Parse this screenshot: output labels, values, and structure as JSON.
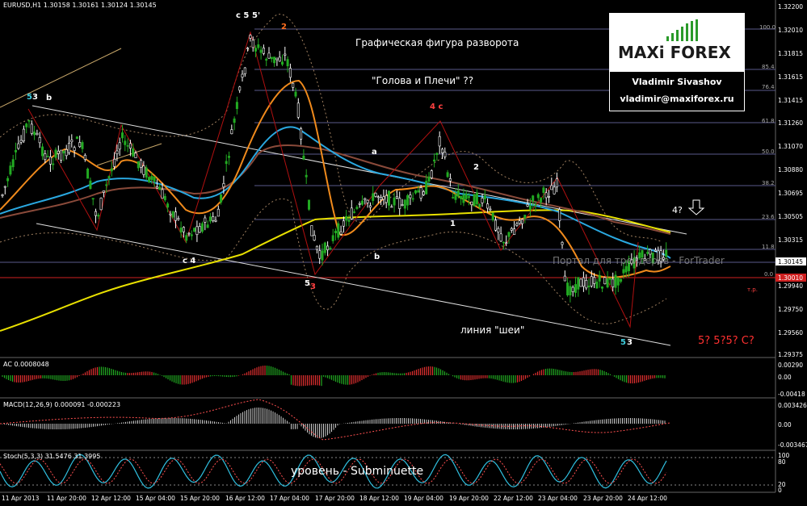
{
  "window": {
    "symbol_header": "EURUSD,H1  1.30158 1.30161 1.30124 1.30145"
  },
  "panes": {
    "ac_title": "AC 0.0008048",
    "macd_title": "MACD(12,26,9) 0.000091 -0.000223",
    "stoch_title": "Stoch(5,3,3) 31.5476 31.3995"
  },
  "price_axis": [
    "1.32200",
    "1.32010",
    "1.31815",
    "1.31615",
    "1.31415",
    "1.31260",
    "1.31070",
    "1.30880",
    "1.30695",
    "1.30505",
    "1.30315",
    "1.30145",
    "1.30010",
    "1.29940",
    "1.29750",
    "1.29560",
    "1.29375"
  ],
  "indicator_axis": {
    "ac": [
      "0.00290",
      "0.00",
      "-0.00418"
    ],
    "macd": [
      "0.003426",
      "0.00",
      "-0.003467"
    ],
    "stoch": [
      "100",
      "80",
      "20",
      "0"
    ]
  },
  "fib_levels": [
    "100.0",
    "85.4",
    "76.4",
    "61.8",
    "50.0",
    "38.2",
    "23.6",
    "11.8",
    "0.0"
  ],
  "tp_label": "т.р.",
  "time_axis": [
    "11 Apr 2013",
    "11 Apr 20:00",
    "12 Apr 12:00",
    "15 Apr 04:00",
    "15 Apr 20:00",
    "16 Apr 12:00",
    "17 Apr 04:00",
    "17 Apr 20:00",
    "18 Apr 12:00",
    "19 Apr 04:00",
    "19 Apr 20:00",
    "22 Apr 12:00",
    "23 Apr 04:00",
    "23 Apr 20:00",
    "24 Apr 12:00"
  ],
  "annotations": {
    "pattern_title": "Графическая фигура разворота",
    "pattern_name": "\"Голова и Плечи\" ??",
    "neckline": "линия \"шеи\"",
    "level": "уровень - Subminuette",
    "target_4": "4?",
    "target_5": "5? 5?5? C?"
  },
  "waves": {
    "w_5_3": "5",
    "w_3_a": "3",
    "w_b_top": "b",
    "w_c5": "c 5",
    "w_5prime": "5'",
    "w_2_red": "2",
    "w_4c": "4 c",
    "w_a_mid": "a",
    "w_2_white": "2",
    "w_1": "1",
    "w_b_low": "b",
    "w_5_3_low": "5",
    "w_3_low": "3",
    "w_c4": "c 4",
    "w_53_right": "5",
    "w_3_right": "3"
  },
  "logo": {
    "brand_maxi": "MAXi",
    "brand_forex": "FOREX",
    "author": "Vladimir Sivashov",
    "email": "vladimir@maxiforex.ru"
  },
  "watermark": "Портал для трейдеров - ForTrader",
  "colors": {
    "background": "#000000",
    "bull_candle": "#22aa22",
    "bear_candle": "#ffffff",
    "ma_yellow": "#e8e000",
    "ma_orange": "#f08a1c",
    "ma_blue": "#2aa8e0",
    "ma_brown": "#8a4a3a",
    "wave_red": "#ff4040",
    "wave_magenta": "#e040e0",
    "wave_cyan": "#40d0e0",
    "wave_orange": "#ff7020"
  }
}
